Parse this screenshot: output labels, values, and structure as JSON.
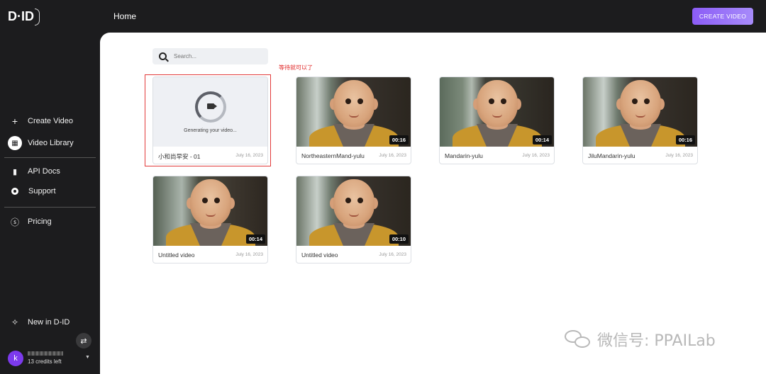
{
  "header": {
    "logo": "D·ID",
    "title": "Home",
    "create_button": "CREATE VIDEO"
  },
  "sidebar": {
    "items": [
      {
        "label": "Create Video",
        "icon": "plus-icon"
      },
      {
        "label": "Video Library",
        "icon": "grid-icon"
      },
      {
        "label": "API Docs",
        "icon": "document-icon"
      },
      {
        "label": "Support",
        "icon": "lifebuoy-icon"
      },
      {
        "label": "Pricing",
        "icon": "dollar-icon"
      },
      {
        "label": "New in D-ID",
        "icon": "sparkle-icon"
      }
    ],
    "user": {
      "initial": "k",
      "credits": "13 credits left"
    }
  },
  "search": {
    "placeholder": "Search..."
  },
  "annotation": "等待就可以了",
  "videos": [
    {
      "title": "小和尚早安 - 01",
      "date": "July 16, 2023",
      "status": "Generating your video...",
      "duration": ""
    },
    {
      "title": "NortheasternMand-yulu",
      "date": "July 16, 2023",
      "duration": "00:16"
    },
    {
      "title": "Mandarin-yulu",
      "date": "July 16, 2023",
      "duration": "00:14"
    },
    {
      "title": "JiluMandarin-yulu",
      "date": "July 16, 2023",
      "duration": "00:16"
    },
    {
      "title": "Untitled video",
      "date": "July 16, 2023",
      "duration": "00:14"
    },
    {
      "title": "Untitled video",
      "date": "July 16, 2023",
      "duration": "00:10"
    }
  ],
  "watermark": "微信号: PPAILab",
  "colors": {
    "accent": "#8b5cf6",
    "highlight": "#e23a3a",
    "sidebar_bg": "#1c1c1e"
  }
}
